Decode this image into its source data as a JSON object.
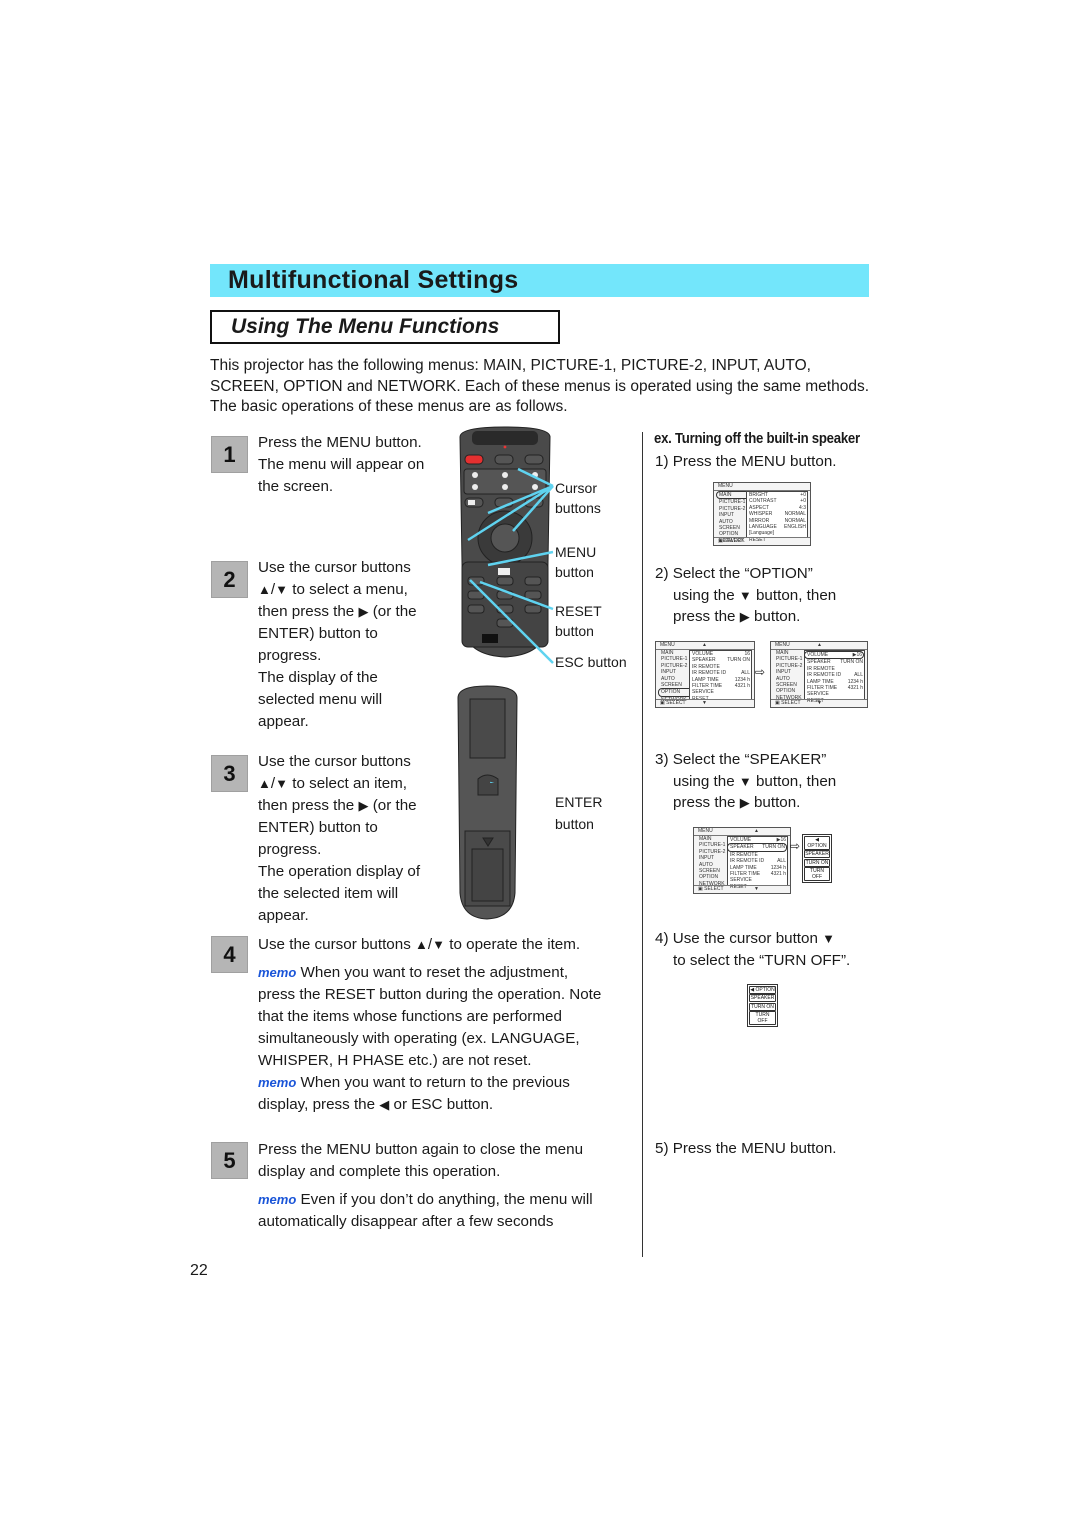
{
  "header": {
    "section_title": "Multifunctional Settings",
    "subsection_title": "Using The Menu Functions",
    "banner_color": "#73e6fb"
  },
  "intro": "This projector has the following menus: MAIN, PICTURE-1, PICTURE-2, INPUT, AUTO, SCREEN, OPTION and NETWORK. Each of these menus is operated using the same methods. The basic operations of these menus are as follows.",
  "steps": [
    {
      "num": "1",
      "lines": [
        "Press the MENU button.",
        "The menu will appear on",
        "the screen."
      ]
    },
    {
      "num": "2",
      "lines": [
        "Use the cursor buttons",
        "to select a menu,",
        "then press the",
        "(or the",
        "ENTER) button to",
        "progress.",
        "The display of the",
        "selected menu will",
        "appear."
      ]
    },
    {
      "num": "3",
      "lines": [
        "Use the cursor buttons",
        "to select an item,",
        "then press the",
        "(or the",
        "ENTER) button to",
        "progress.",
        "The operation display of",
        "the selected item will",
        "appear."
      ]
    },
    {
      "num": "4",
      "lines": [
        "Use the cursor buttons",
        "to operate the item."
      ],
      "memos": [
        {
          "label": "memo",
          "lines": [
            "When you want to reset the adjustment,",
            "press the RESET button during the operation. Note",
            "that the items whose functions are performed",
            "simultaneously with operating (ex. LANGUAGE,",
            "WHISPER, H PHASE etc.) are not reset."
          ]
        },
        {
          "label": "memo",
          "lines": [
            "When you want to return to the previous",
            "display, press the",
            "or ESC button."
          ]
        }
      ]
    },
    {
      "num": "5",
      "lines": [
        "Press the MENU button again to close the menu",
        "display and complete this operation."
      ],
      "memos": [
        {
          "label": "memo",
          "lines": [
            "Even if you don’t do anything, the menu will",
            "automatically disappear after a few seconds"
          ]
        }
      ]
    }
  ],
  "symbols": {
    "up": "▲",
    "down": "▼",
    "right": "▶",
    "left": "◀",
    "slash": "/",
    "arrow": "⇨"
  },
  "remote_callouts": {
    "cursor": [
      "Cursor",
      "buttons"
    ],
    "menu": [
      "MENU",
      "button"
    ],
    "reset": [
      "RESET",
      "button"
    ],
    "esc": "ESC button",
    "enter": [
      "ENTER",
      "button"
    ],
    "callout_color": "#5fd3f0"
  },
  "example": {
    "title": "ex. Turning off the built-in speaker",
    "steps": [
      {
        "lines": [
          "1) Press the MENU button."
        ]
      },
      {
        "lines": [
          "2) Select the “OPTION”",
          "using the",
          "button, then",
          "press the",
          "button."
        ]
      },
      {
        "lines": [
          "3) Select the “SPEAKER”",
          "using the",
          "button, then",
          "press the",
          "button."
        ]
      },
      {
        "lines": [
          "4) Use the cursor button",
          "to select the “TURN OFF”."
        ]
      },
      {
        "lines": [
          "5) Press the MENU button."
        ]
      }
    ],
    "osd_main": {
      "title": "MENU",
      "menus": [
        "MAIN",
        "PICTURE-1",
        "PICTURE-2",
        "INPUT",
        "AUTO",
        "SCREEN",
        "OPTION",
        "NETWORK"
      ],
      "items": [
        [
          "BRIGHT",
          "+0"
        ],
        [
          "CONTRAST",
          "+0"
        ],
        [
          "ASPECT",
          "4:3"
        ],
        [
          "WHISPER",
          "NORMAL"
        ],
        [
          "MIRROR",
          "NORMAL"
        ],
        [
          "LANGUAGE",
          "ENGLISH"
        ],
        [
          "[Language]",
          ""
        ],
        [
          "RESET",
          ""
        ]
      ],
      "footer": "SELECT"
    },
    "osd_option": {
      "title": "MENU",
      "items": [
        [
          "VOLUME",
          "16"
        ],
        [
          "SPEAKER",
          "TURN ON"
        ],
        [
          "IR REMOTE",
          ""
        ],
        [
          "IR REMOTE ID",
          "ALL"
        ],
        [
          "LAMP TIME",
          "1234 h"
        ],
        [
          "FILTER TIME",
          "4321 h"
        ],
        [
          "SERVICE",
          ""
        ],
        [
          "RESET",
          ""
        ]
      ],
      "footer": "SELECT"
    },
    "speaker_popup": [
      "◀ OPTION",
      "SPEAKER",
      "TURN ON",
      "TURN OFF"
    ]
  },
  "page_number": "22"
}
